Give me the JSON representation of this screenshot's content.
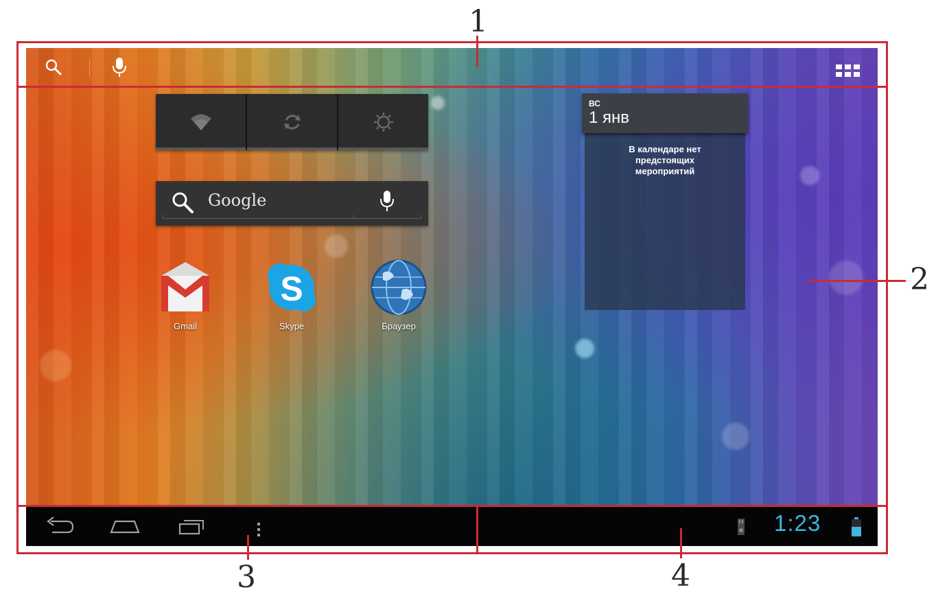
{
  "callouts": [
    "1",
    "2",
    "3",
    "4"
  ],
  "topbar": {
    "search_icon": "search-icon",
    "voice_icon": "microphone-icon",
    "apps_icon": "apps-grid-icon"
  },
  "power_widget": {
    "toggles": [
      {
        "icon": "wifi-icon",
        "state": "off"
      },
      {
        "icon": "sync-icon",
        "state": "off"
      },
      {
        "icon": "brightness-icon",
        "state": "off"
      }
    ]
  },
  "google_widget": {
    "label": "Google"
  },
  "apps": [
    {
      "label": "Gmail",
      "icon": "gmail-icon",
      "color": "#d83b2f"
    },
    {
      "label": "Skype",
      "icon": "skype-icon",
      "color": "#1ba4e6"
    },
    {
      "label": "Браузер",
      "icon": "browser-globe-icon",
      "color": "#2f74b8"
    }
  ],
  "calendar": {
    "day_of_week": "ВС",
    "date": "1 янв",
    "empty_message": "В календаре нет\nпредстоящих\nмероприятий"
  },
  "sysbar": {
    "clock": "1:23",
    "clock_color": "#3fb4e0",
    "status_icons": [
      "sd-card-icon",
      "battery-icon"
    ]
  },
  "colors": {
    "annotation": "#cc2a36",
    "accent": "#3fb4e0"
  }
}
